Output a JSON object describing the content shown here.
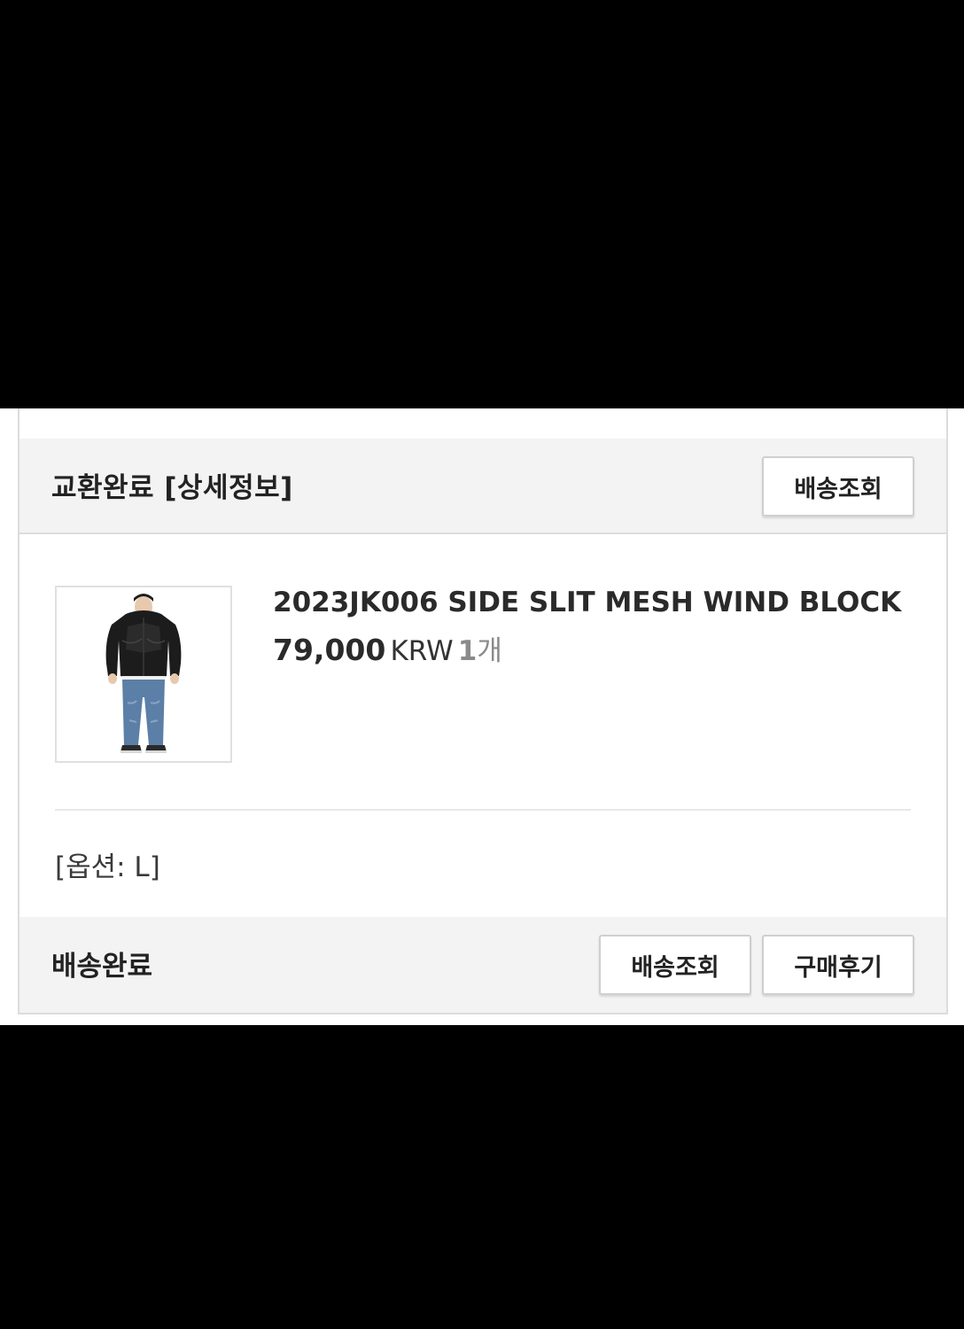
{
  "order": {
    "header": {
      "status_title": "교환완료 [상세정보]",
      "track_button": "배송조회"
    },
    "item": {
      "name": "2023JK006 SIDE SLIT MESH WIND BLOCK",
      "price": "79,000",
      "currency": "KRW",
      "quantity": "1",
      "quantity_unit": "개",
      "option": "[옵션: L]",
      "image_icon": "jacket-model-photo"
    },
    "footer": {
      "status_title": "배송완료",
      "track_button": "배송조회",
      "review_button": "구매후기"
    }
  },
  "colors": {
    "background": "#000000",
    "card_bg": "#ffffff",
    "bar_bg": "#f3f3f3",
    "border": "#dcdcdc",
    "text": "#222222",
    "muted": "#8a8a8a"
  }
}
